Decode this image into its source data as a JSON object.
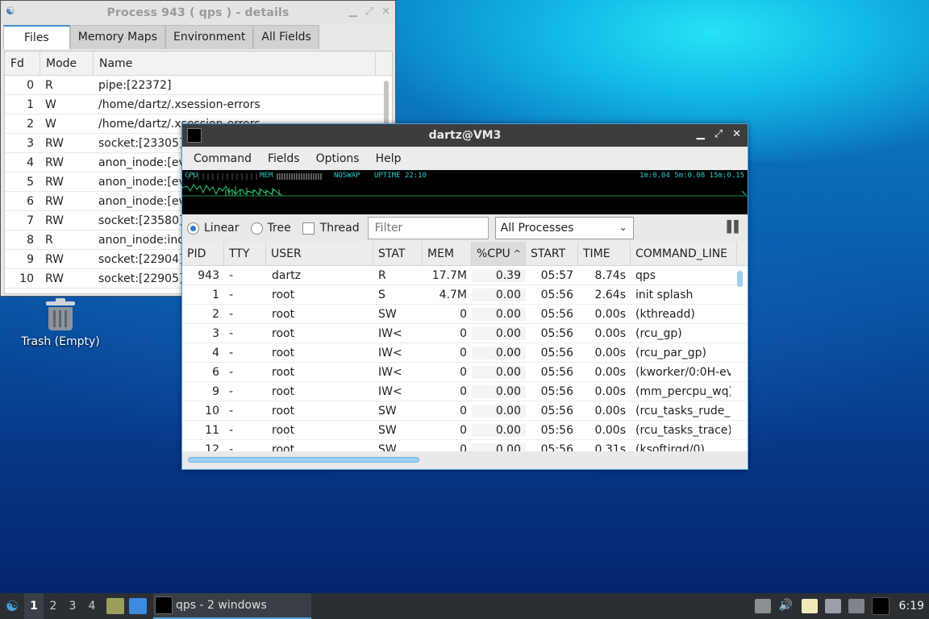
{
  "desktop": {
    "trash_label": "Trash (Empty)"
  },
  "details_window": {
    "title": "Process 943 ( qps ) - details",
    "tabs": [
      "Files",
      "Memory Maps",
      "Environment",
      "All Fields"
    ],
    "columns": [
      "Fd",
      "Mode",
      "Name"
    ],
    "rows": [
      {
        "fd": "0",
        "mode": "R",
        "name": "pipe:[22372]"
      },
      {
        "fd": "1",
        "mode": "W",
        "name": "/home/dartz/.xsession-errors"
      },
      {
        "fd": "2",
        "mode": "W",
        "name": "/home/dartz/.xsession-errors"
      },
      {
        "fd": "3",
        "mode": "RW",
        "name": "socket:[23305]"
      },
      {
        "fd": "4",
        "mode": "RW",
        "name": "anon_inode:[ev"
      },
      {
        "fd": "5",
        "mode": "RW",
        "name": "anon_inode:[ev"
      },
      {
        "fd": "6",
        "mode": "RW",
        "name": "anon_inode:[ev"
      },
      {
        "fd": "7",
        "mode": "RW",
        "name": "socket:[23580]"
      },
      {
        "fd": "8",
        "mode": "R",
        "name": "anon_inode:ino"
      },
      {
        "fd": "9",
        "mode": "RW",
        "name": "socket:[22904]"
      },
      {
        "fd": "10",
        "mode": "RW",
        "name": "socket:[22905]"
      }
    ]
  },
  "main_window": {
    "title": "dartz@VM3",
    "menu": [
      "Command",
      "Fields",
      "Options",
      "Help"
    ],
    "monitor": {
      "cpu": "CPU",
      "mem": "MEM",
      "swap": "NOSWAP",
      "uptime": "UPTIME 22:10",
      "load": "1m:0.04 5m:0.08 15m:0.15"
    },
    "view_modes": [
      "Linear",
      "Tree"
    ],
    "thread_label": "Thread",
    "filter_placeholder": "Filter",
    "process_filter": "All Processes",
    "columns": [
      "PID",
      "TTY",
      "USER",
      "STAT",
      "MEM",
      "%CPU",
      "START",
      "TIME",
      "COMMAND_LINE"
    ],
    "rows": [
      {
        "pid": "943",
        "tty": "-",
        "user": "dartz",
        "stat": "R",
        "mem": "17.7M",
        "cpu": "0.39",
        "start": "05:57",
        "time": "8.74s",
        "cmd": "qps"
      },
      {
        "pid": "1",
        "tty": "-",
        "user": "root",
        "stat": "S",
        "mem": "4.7M",
        "cpu": "0.00",
        "start": "05:56",
        "time": "2.64s",
        "cmd": "init splash"
      },
      {
        "pid": "2",
        "tty": "-",
        "user": "root",
        "stat": "SW",
        "mem": "0",
        "cpu": "0.00",
        "start": "05:56",
        "time": "0.00s",
        "cmd": "(kthreadd)"
      },
      {
        "pid": "3",
        "tty": "-",
        "user": "root",
        "stat": "IW<",
        "mem": "0",
        "cpu": "0.00",
        "start": "05:56",
        "time": "0.00s",
        "cmd": "(rcu_gp)"
      },
      {
        "pid": "4",
        "tty": "-",
        "user": "root",
        "stat": "IW<",
        "mem": "0",
        "cpu": "0.00",
        "start": "05:56",
        "time": "0.00s",
        "cmd": "(rcu_par_gp)"
      },
      {
        "pid": "6",
        "tty": "-",
        "user": "root",
        "stat": "IW<",
        "mem": "0",
        "cpu": "0.00",
        "start": "05:56",
        "time": "0.00s",
        "cmd": "(kworker/0:0H-ev"
      },
      {
        "pid": "9",
        "tty": "-",
        "user": "root",
        "stat": "IW<",
        "mem": "0",
        "cpu": "0.00",
        "start": "05:56",
        "time": "0.00s",
        "cmd": "(mm_percpu_wq)"
      },
      {
        "pid": "10",
        "tty": "-",
        "user": "root",
        "stat": "SW",
        "mem": "0",
        "cpu": "0.00",
        "start": "05:56",
        "time": "0.00s",
        "cmd": "(rcu_tasks_rude_"
      },
      {
        "pid": "11",
        "tty": "-",
        "user": "root",
        "stat": "SW",
        "mem": "0",
        "cpu": "0.00",
        "start": "05:56",
        "time": "0.00s",
        "cmd": "(rcu_tasks_trace)"
      },
      {
        "pid": "12",
        "tty": "-",
        "user": "root",
        "stat": "SW",
        "mem": "0",
        "cpu": "0.00",
        "start": "05:56",
        "time": "0.31s",
        "cmd": "(ksoftirqd/0)"
      }
    ]
  },
  "taskbar": {
    "workspaces": [
      "1",
      "2",
      "3",
      "4"
    ],
    "task_label": "qps - 2 windows",
    "clock": "6:19"
  }
}
